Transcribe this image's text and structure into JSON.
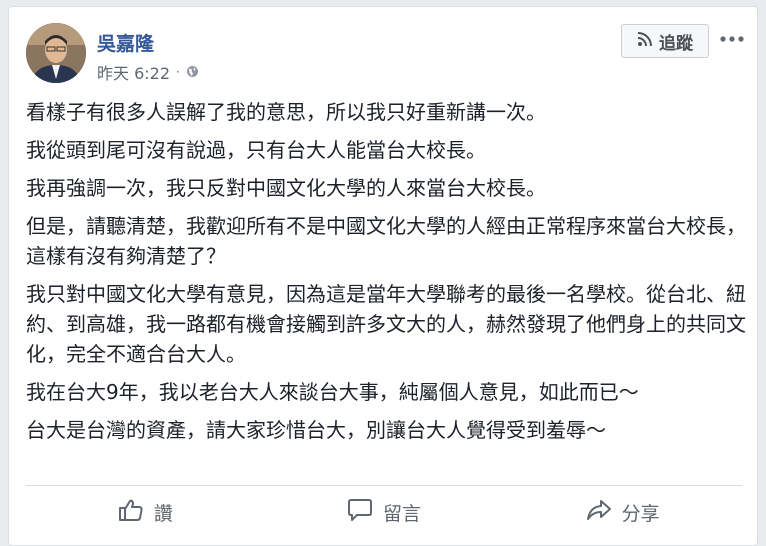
{
  "post": {
    "author": "吳嘉隆",
    "timestamp": "昨天 6:22",
    "separator": "·",
    "privacy_icon": "globe-icon",
    "follow_label": "追蹤",
    "paragraphs": [
      "看樣子有很多人誤解了我的意思，所以我只好重新講一次。",
      "我從頭到尾可沒有說過，只有台大人能當台大校長。",
      "我再強調一次，我只反對中國文化大學的人來當台大校長。",
      "但是，請聽清楚，我歡迎所有不是中國文化大學的人經由正常程序來當台大校長，這樣有沒有夠清楚了？",
      "我只對中國文化大學有意見，因為這是當年大學聯考的最後一名學校。從台北、紐約、到高雄，我一路都有機會接觸到許多文大的人，赫然發現了他們身上的共同文化，完全不適合台大人。",
      "我在台大9年，我以老台大人來談台大事，純屬個人意見，如此而已～",
      "台大是台灣的資產，請大家珍惜台大，別讓台大人覺得受到羞辱～"
    ]
  },
  "actions": {
    "like_label": "讚",
    "comment_label": "留言",
    "share_label": "分享"
  },
  "colors": {
    "author": "#365899",
    "text": "#1d2129",
    "muted": "#606770",
    "background": "#e9ebee"
  }
}
